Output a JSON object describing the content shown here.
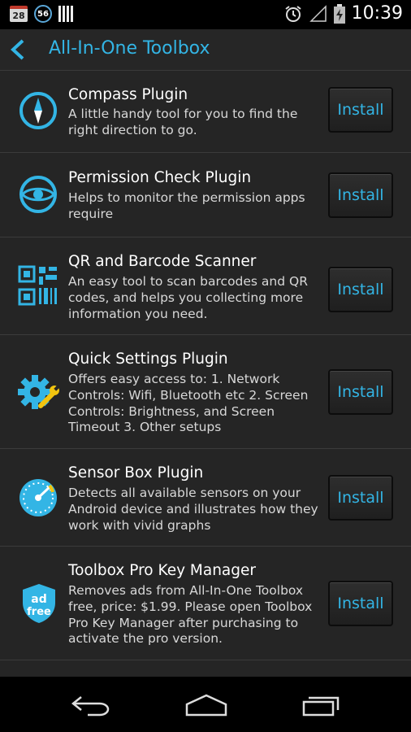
{
  "status_bar": {
    "calendar_day": "28",
    "notification_count": "56",
    "time": "10:39",
    "icons": [
      "calendar-icon",
      "circle-badge-icon",
      "barcode-icon",
      "alarm-icon",
      "signal-icon",
      "battery-charging-icon"
    ]
  },
  "app_bar": {
    "title": "All-In-One Toolbox",
    "back_icon": "chevron-left-icon"
  },
  "plugins": [
    {
      "title": "Compass Plugin",
      "description": "A little handy tool for you to find the right direction to go.",
      "button": "Install",
      "icon": "compass-icon"
    },
    {
      "title": "Permission Check Plugin",
      "description": "Helps to monitor the permission apps require",
      "button": "Install",
      "icon": "eye-icon"
    },
    {
      "title": "QR and Barcode Scanner",
      "description": "An easy tool to scan barcodes and QR codes, and helps you collecting  more information you need.",
      "button": "Install",
      "icon": "qr-code-icon"
    },
    {
      "title": "Quick Settings Plugin",
      "description": "Offers easy access to: 1. Network Controls: Wifi, Bluetooth etc 2. Screen Controls: Brightness, and Screen Timeout 3. Other setups",
      "button": "Install",
      "icon": "gear-wrench-icon"
    },
    {
      "title": "Sensor Box Plugin",
      "description": "Detects all available sensors on your Android device and illustrates how they work with vivid graphs",
      "button": "Install",
      "icon": "gauge-icon"
    },
    {
      "title": "Toolbox Pro Key Manager",
      "description": "Removes ads from All-In-One Toolbox free, price: $1.99. Please open Toolbox Pro Key Manager after purchasing to activate the pro version.",
      "button": "Install",
      "icon": "ad-free-shield-icon",
      "icon_text_1": "ad",
      "icon_text_2": "free"
    }
  ],
  "nav_bar": {
    "icons": [
      "back-icon",
      "home-icon",
      "recents-icon"
    ]
  },
  "colors": {
    "accent": "#33b5e5",
    "background": "#252525",
    "app_bar": "#262626",
    "divider": "#3b3b3b"
  }
}
